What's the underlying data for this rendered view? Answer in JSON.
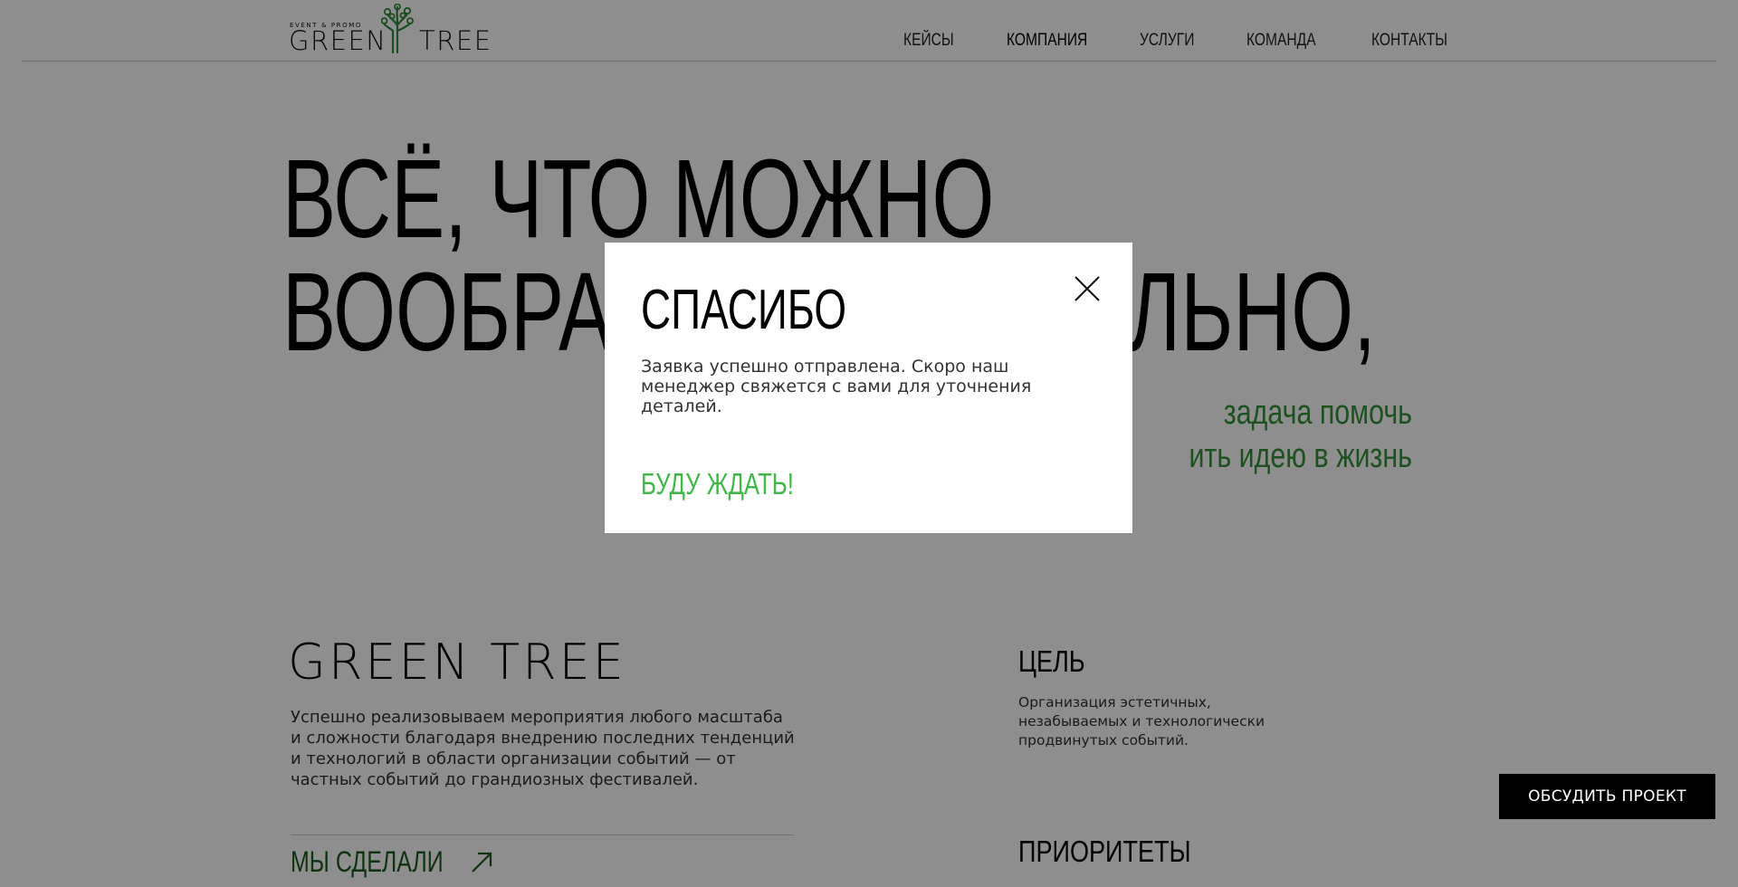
{
  "header": {
    "logo": {
      "tagline": "EVENT & PROMO",
      "word1": "GREEN",
      "word2": "TREE",
      "tree_icon": "tree-icon",
      "brand_color": "#2f8a3a"
    },
    "nav": [
      {
        "label": "КЕЙСЫ",
        "active": false
      },
      {
        "label": "КОМПАНИЯ",
        "active": true
      },
      {
        "label": "УСЛУГИ",
        "active": false
      },
      {
        "label": "КОМАНДА",
        "active": false
      },
      {
        "label": "КОНТАКТЫ",
        "active": false
      }
    ]
  },
  "hero": {
    "title_line1": "ВСЁ, ЧТО МОЖНО",
    "title_line2": "ВООБРАЗИТЬ, — РЕАЛЬНО,",
    "subtitle_line1": "задача помочь",
    "subtitle_line2": "ить идею в жизнь",
    "accent_color": "#35923a"
  },
  "about": {
    "logo_text": "GREEN TREE",
    "text": "Успешно реализовываем мероприятия любого масштаба и сложности благодаря внедрению последних тенденций и технологий в области организации событий — от частных событий до грандиозных фестивалей.",
    "link_label": "МЫ СДЕЛАЛИ",
    "link_icon": "arrow-up-right-icon"
  },
  "goal": {
    "title": "ЦЕЛЬ",
    "text": "Организация эстетичных, незабываемых и технологически продвинутых событий."
  },
  "priorities": {
    "title": "ПРИОРИТЕТЫ"
  },
  "cta": {
    "label": "ОБСУДИТЬ ПРОЕКТ"
  },
  "modal": {
    "title": "СПАСИБО",
    "text": "Заявка успешно отправлена. Скоро наш менеджер свяжется с вами для уточнения деталей.",
    "action_label": "БУДУ ЖДАТЬ!",
    "close_icon": "close-icon",
    "action_color": "#43b54a"
  }
}
